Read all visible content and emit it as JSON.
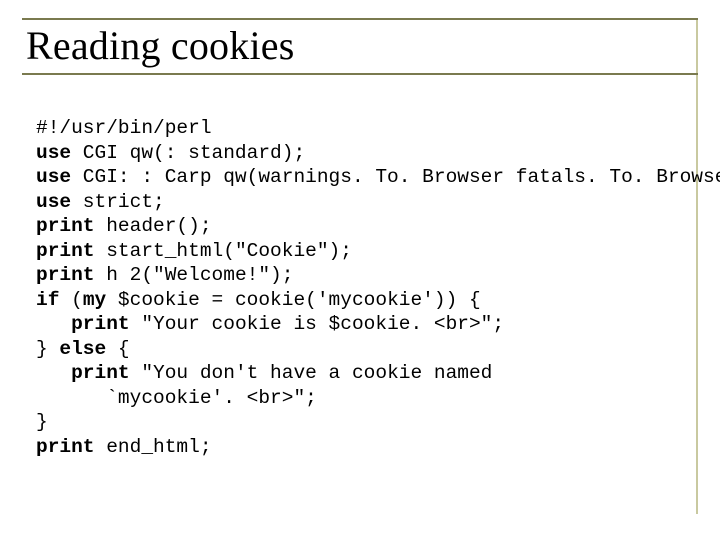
{
  "title": "Reading cookies",
  "code": {
    "l1": "#!/usr/bin/perl",
    "l2a": "use",
    "l2b": " CGI qw(: standard);",
    "l3a": "use",
    "l3b": " CGI: : Carp qw(warnings. To. Browser fatals. To. Browser);",
    "l4a": "use",
    "l4b": " strict;",
    "l5a": "print",
    "l5b": " header();",
    "l6a": "print",
    "l6b": " start_html(\"Cookie\");",
    "l7a": "print",
    "l7b": " h 2(\"Welcome!\");",
    "l8a": "if",
    "l8b": " (",
    "l8c": "my",
    "l8d": " $cookie = cookie('mycookie')) {",
    "l9a": "   ",
    "l9b": "print",
    "l9c": " \"Your cookie is $cookie. <br>\";",
    "l10a": "} ",
    "l10b": "else",
    "l10c": " {",
    "l11a": "   ",
    "l11b": "print",
    "l11c": " \"You don't have a cookie named",
    "l12": "      `mycookie'. <br>\";",
    "l13": "}",
    "l14a": "print",
    "l14b": " end_html;"
  }
}
